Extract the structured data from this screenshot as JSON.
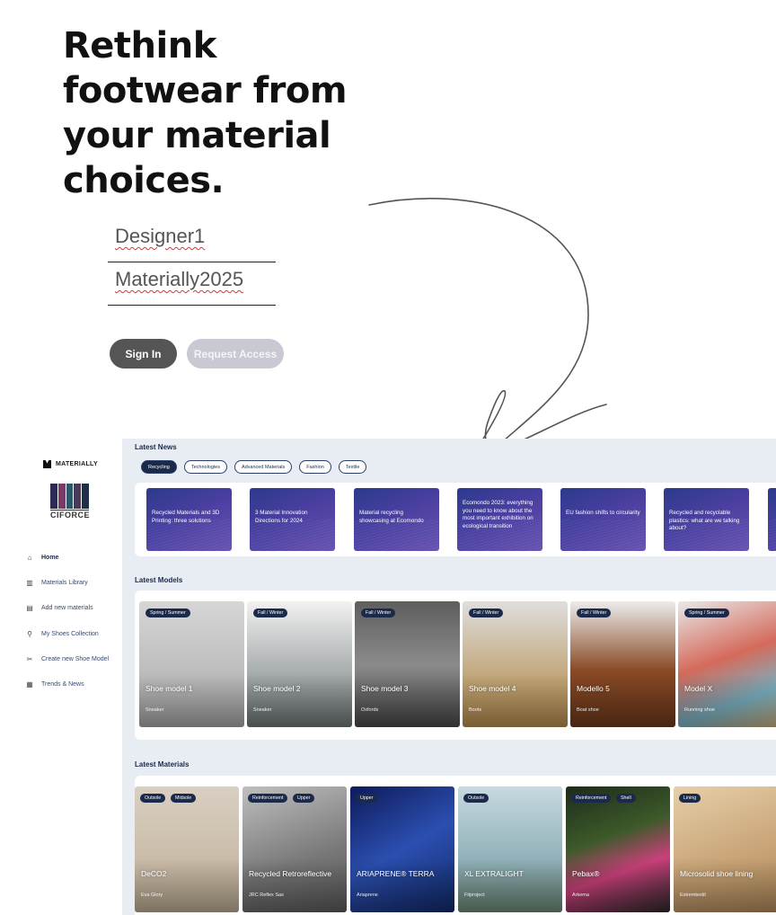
{
  "hero": {
    "title": "Rethink footwear from your material choices.",
    "username_value": "Designer1",
    "password_value": "Materially2025",
    "signin_label": "Sign In",
    "request_label": "Request Access"
  },
  "sidebar": {
    "brand": "MATERIALLY",
    "partner_logo": "CIFORCE",
    "items": [
      {
        "label": "Home",
        "icon": "home-icon"
      },
      {
        "label": "Materials Library",
        "icon": "book-icon"
      },
      {
        "label": "Add new materials",
        "icon": "chat-plus-icon"
      },
      {
        "label": "My Shoes Collection",
        "icon": "walking-icon"
      },
      {
        "label": "Create new Shoe Model",
        "icon": "scissors-icon"
      },
      {
        "label": "Trends & News",
        "icon": "newspaper-icon"
      }
    ]
  },
  "news": {
    "title": "Latest News",
    "chips": [
      "Recycling",
      "Technologies",
      "Advanced Materials",
      "Fashion",
      "Textile"
    ],
    "cards": [
      "Recycled Materials and 3D Printing: three solutions",
      "3 Material Innovation Directions for 2024",
      "Material recycling showcasing at Ecomondo",
      "Ecomondo 2023: everything you need to know about the most important exhibition on ecological transition",
      "EU fashion shifts to circularity",
      "Recycled and recyclable plastics: what are we talking about?"
    ]
  },
  "models": {
    "title": "Latest Models",
    "cards": [
      {
        "season": "Spring / Summer",
        "name": "Shoe model 1",
        "type": "Sneaker"
      },
      {
        "season": "Fall / Winter",
        "name": "Shoe model 2",
        "type": "Sneaker"
      },
      {
        "season": "Fall / Winter",
        "name": "Shoe model 3",
        "type": "Oxfords"
      },
      {
        "season": "Fall / Winter",
        "name": "Shoe model 4",
        "type": "Boots"
      },
      {
        "season": "Fall / Winter",
        "name": "Modello 5",
        "type": "Boat shoe"
      },
      {
        "season": "Spring / Summer",
        "name": "Model X",
        "type": "Running shoe"
      }
    ]
  },
  "materials": {
    "title": "Latest Materials",
    "cards": [
      {
        "tags": [
          "Outsole",
          "Midsole"
        ],
        "name": "DeCO2",
        "maker": "Eva Glory"
      },
      {
        "tags": [
          "Reinforcement",
          "Upper"
        ],
        "name": "Recycled Retroreflective",
        "maker": "JRC Reflex Sas"
      },
      {
        "tags": [
          "Upper"
        ],
        "name": "ARIAPRENE® TERRA",
        "maker": "Ariaprene"
      },
      {
        "tags": [
          "Outsole"
        ],
        "name": "XL EXTRALIGHT",
        "maker": "Fitproject"
      },
      {
        "tags": [
          "Reinforcement",
          "Shell"
        ],
        "name": "Pebax®",
        "maker": "Arkema"
      },
      {
        "tags": [
          "Lining"
        ],
        "name": "Microsolid shoe lining",
        "maker": "Extremtextil"
      }
    ]
  }
}
